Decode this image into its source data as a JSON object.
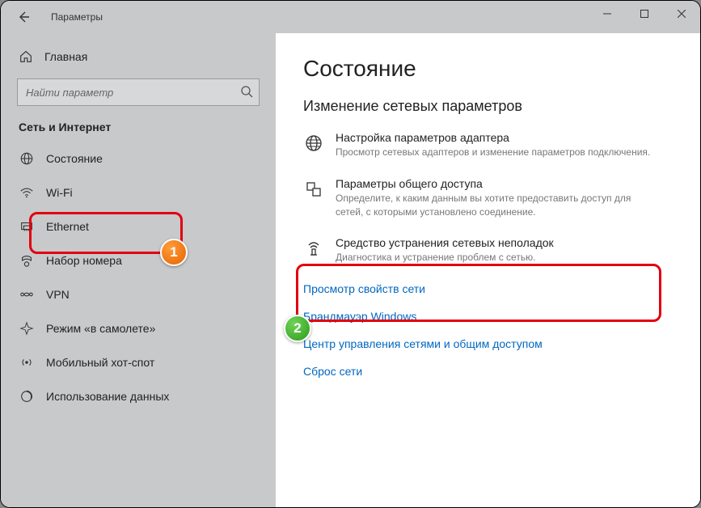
{
  "titlebar": {
    "title": "Параметры"
  },
  "sidebar": {
    "home": "Главная",
    "search_placeholder": "Найти параметр",
    "category": "Сеть и Интернет",
    "items": [
      {
        "label": "Состояние"
      },
      {
        "label": "Wi-Fi"
      },
      {
        "label": "Ethernet"
      },
      {
        "label": "Набор номера"
      },
      {
        "label": "VPN"
      },
      {
        "label": "Режим «в самолете»"
      },
      {
        "label": "Мобильный хот-спот"
      },
      {
        "label": "Использование данных"
      }
    ]
  },
  "main": {
    "heading": "Состояние",
    "subheading": "Изменение сетевых параметров",
    "settings": [
      {
        "title": "Настройка параметров адаптера",
        "desc": "Просмотр сетевых адаптеров и изменение параметров подключения."
      },
      {
        "title": "Параметры общего доступа",
        "desc": "Определите, к каким данным вы хотите предоставить доступ для сетей, с которыми установлено соединение."
      },
      {
        "title": "Средство устранения сетевых неполадок",
        "desc": "Диагностика и устранение проблем с сетью."
      }
    ],
    "links": [
      "Просмотр свойств сети",
      "Брандмауэр Windows",
      "Центр управления сетями и общим доступом",
      "Сброс сети"
    ]
  },
  "badges": {
    "one": "1",
    "two": "2"
  }
}
